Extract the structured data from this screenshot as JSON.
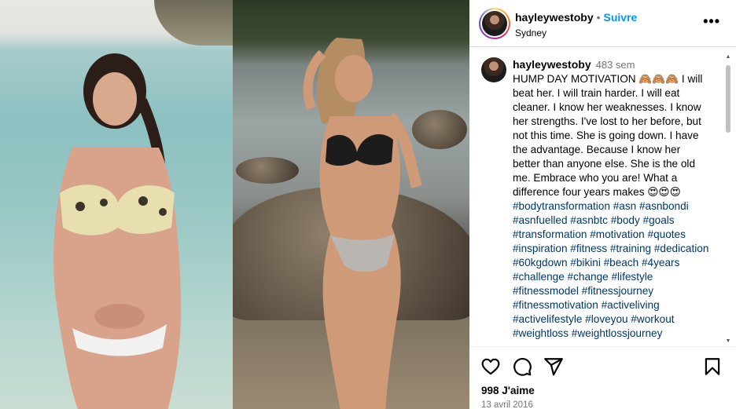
{
  "post": {
    "username": "hayleywestoby",
    "separator": "•",
    "follow_label": "Suivre",
    "location": "Sydney",
    "more_label": "•••"
  },
  "caption": {
    "username": "hayleywestoby",
    "time": "483 sem",
    "text": "HUMP DAY MOTIVATION 🙈🙈🙈 I will beat her. I will train harder. I will eat cleaner. I know her weaknesses. I know her strengths. I've lost to her before, but not this time. She is going down. I have the advantage. Because I know her better than anyone else. She is the old me. Embrace who you are! What a difference four years makes 😍😍😍",
    "hashtags": "#bodytransformation #asn #asnbondi #asnfuelled #asnbtc #body #goals #transformation #motivation #quotes #inspiration #fitness #training #dedication #60kgdown #bikini #beach #4years #challenge #change #lifestyle #fitnessmodel #fitnessjourney #fitnessmotivation #activeliving #activelifestyle #loveyou #workout #weightloss #weightlossjourney"
  },
  "footer": {
    "likes": "998 J'aime",
    "date": "13 avril 2016"
  },
  "icons": {
    "like": "heart-icon",
    "comment": "comment-icon",
    "share": "share-icon",
    "save": "bookmark-icon",
    "more": "more-horizontal-icon"
  },
  "colors": {
    "accent": "#0095f6",
    "hashtag": "#00376b",
    "muted": "#737373",
    "border": "#dbdbdb"
  }
}
